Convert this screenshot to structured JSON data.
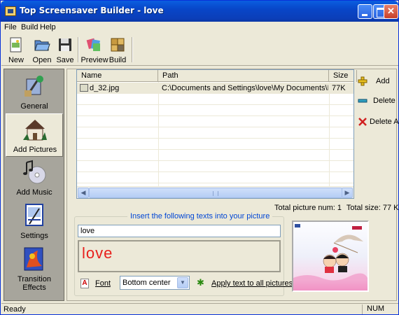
{
  "window": {
    "title": "Top Screensaver Builder - love"
  },
  "menu": [
    "File",
    "Build",
    "Help"
  ],
  "toolbar": {
    "new": "New",
    "open": "Open",
    "save": "Save",
    "preview": "Preview",
    "build": "Build"
  },
  "sidebar": {
    "items": [
      {
        "label": "General",
        "icon": "general-icon"
      },
      {
        "label": "Add Pictures",
        "icon": "house-icon"
      },
      {
        "label": "Add Music",
        "icon": "music-icon"
      },
      {
        "label": "Settings",
        "icon": "settings-icon"
      },
      {
        "label": "Transition Effects",
        "icon": "transition-icon"
      }
    ],
    "active": "Add Pictures"
  },
  "filelist": {
    "columns": [
      "Name",
      "Path",
      "Size"
    ],
    "rows": [
      {
        "name": "d_32.jpg",
        "path": "C:\\Documents and Settings\\love\\My Documents\\My Pictures...",
        "size": "77K"
      }
    ]
  },
  "actions": {
    "add": "Add",
    "delete": "Delete",
    "delete_all": "Delete All"
  },
  "totals": {
    "picture_num": "Total picture num: 1",
    "size": "Total size: 77 K"
  },
  "text_group": {
    "title": "Insert the following texts into your picture",
    "text_value": "love",
    "preview_text": "love",
    "font_label": "Font",
    "position": "Bottom center",
    "apply_label": "Apply text to all pictures"
  },
  "status": {
    "text": "Ready",
    "num": "NUM"
  },
  "colors": {
    "titlebar": "#0846c8",
    "preview_text": "#e8201c",
    "group_title": "#0046d5"
  }
}
